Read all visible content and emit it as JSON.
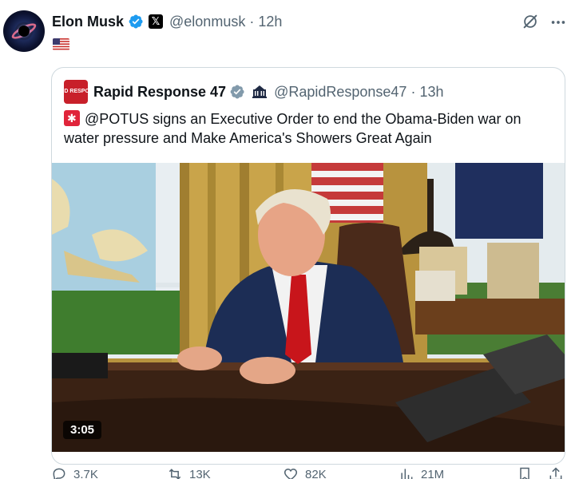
{
  "author": {
    "name": "Elon Musk",
    "handle": "@elonmusk",
    "separator": "·",
    "time": "12h",
    "flag_icon": "us-flag-icon"
  },
  "quoted": {
    "name": "Rapid Response 47",
    "handle": "@RapidResponse47",
    "separator": "·",
    "time": "13h",
    "avatar_text": "RAPID RESPONSE",
    "text": "@POTUS signs an Executive Order to end the Obama-Biden war on water pressure and Make America's Showers Great Again",
    "media": {
      "type": "video",
      "duration": "3:05"
    }
  },
  "actions": {
    "replies": "3.7K",
    "reposts": "13K",
    "likes": "82K",
    "views": "21M"
  },
  "colors": {
    "verified_blue": "#1d9bf0",
    "gov_gray": "#829aab",
    "text_secondary": "#536471",
    "border": "#cfd9de",
    "brand_red": "#c8202a"
  }
}
